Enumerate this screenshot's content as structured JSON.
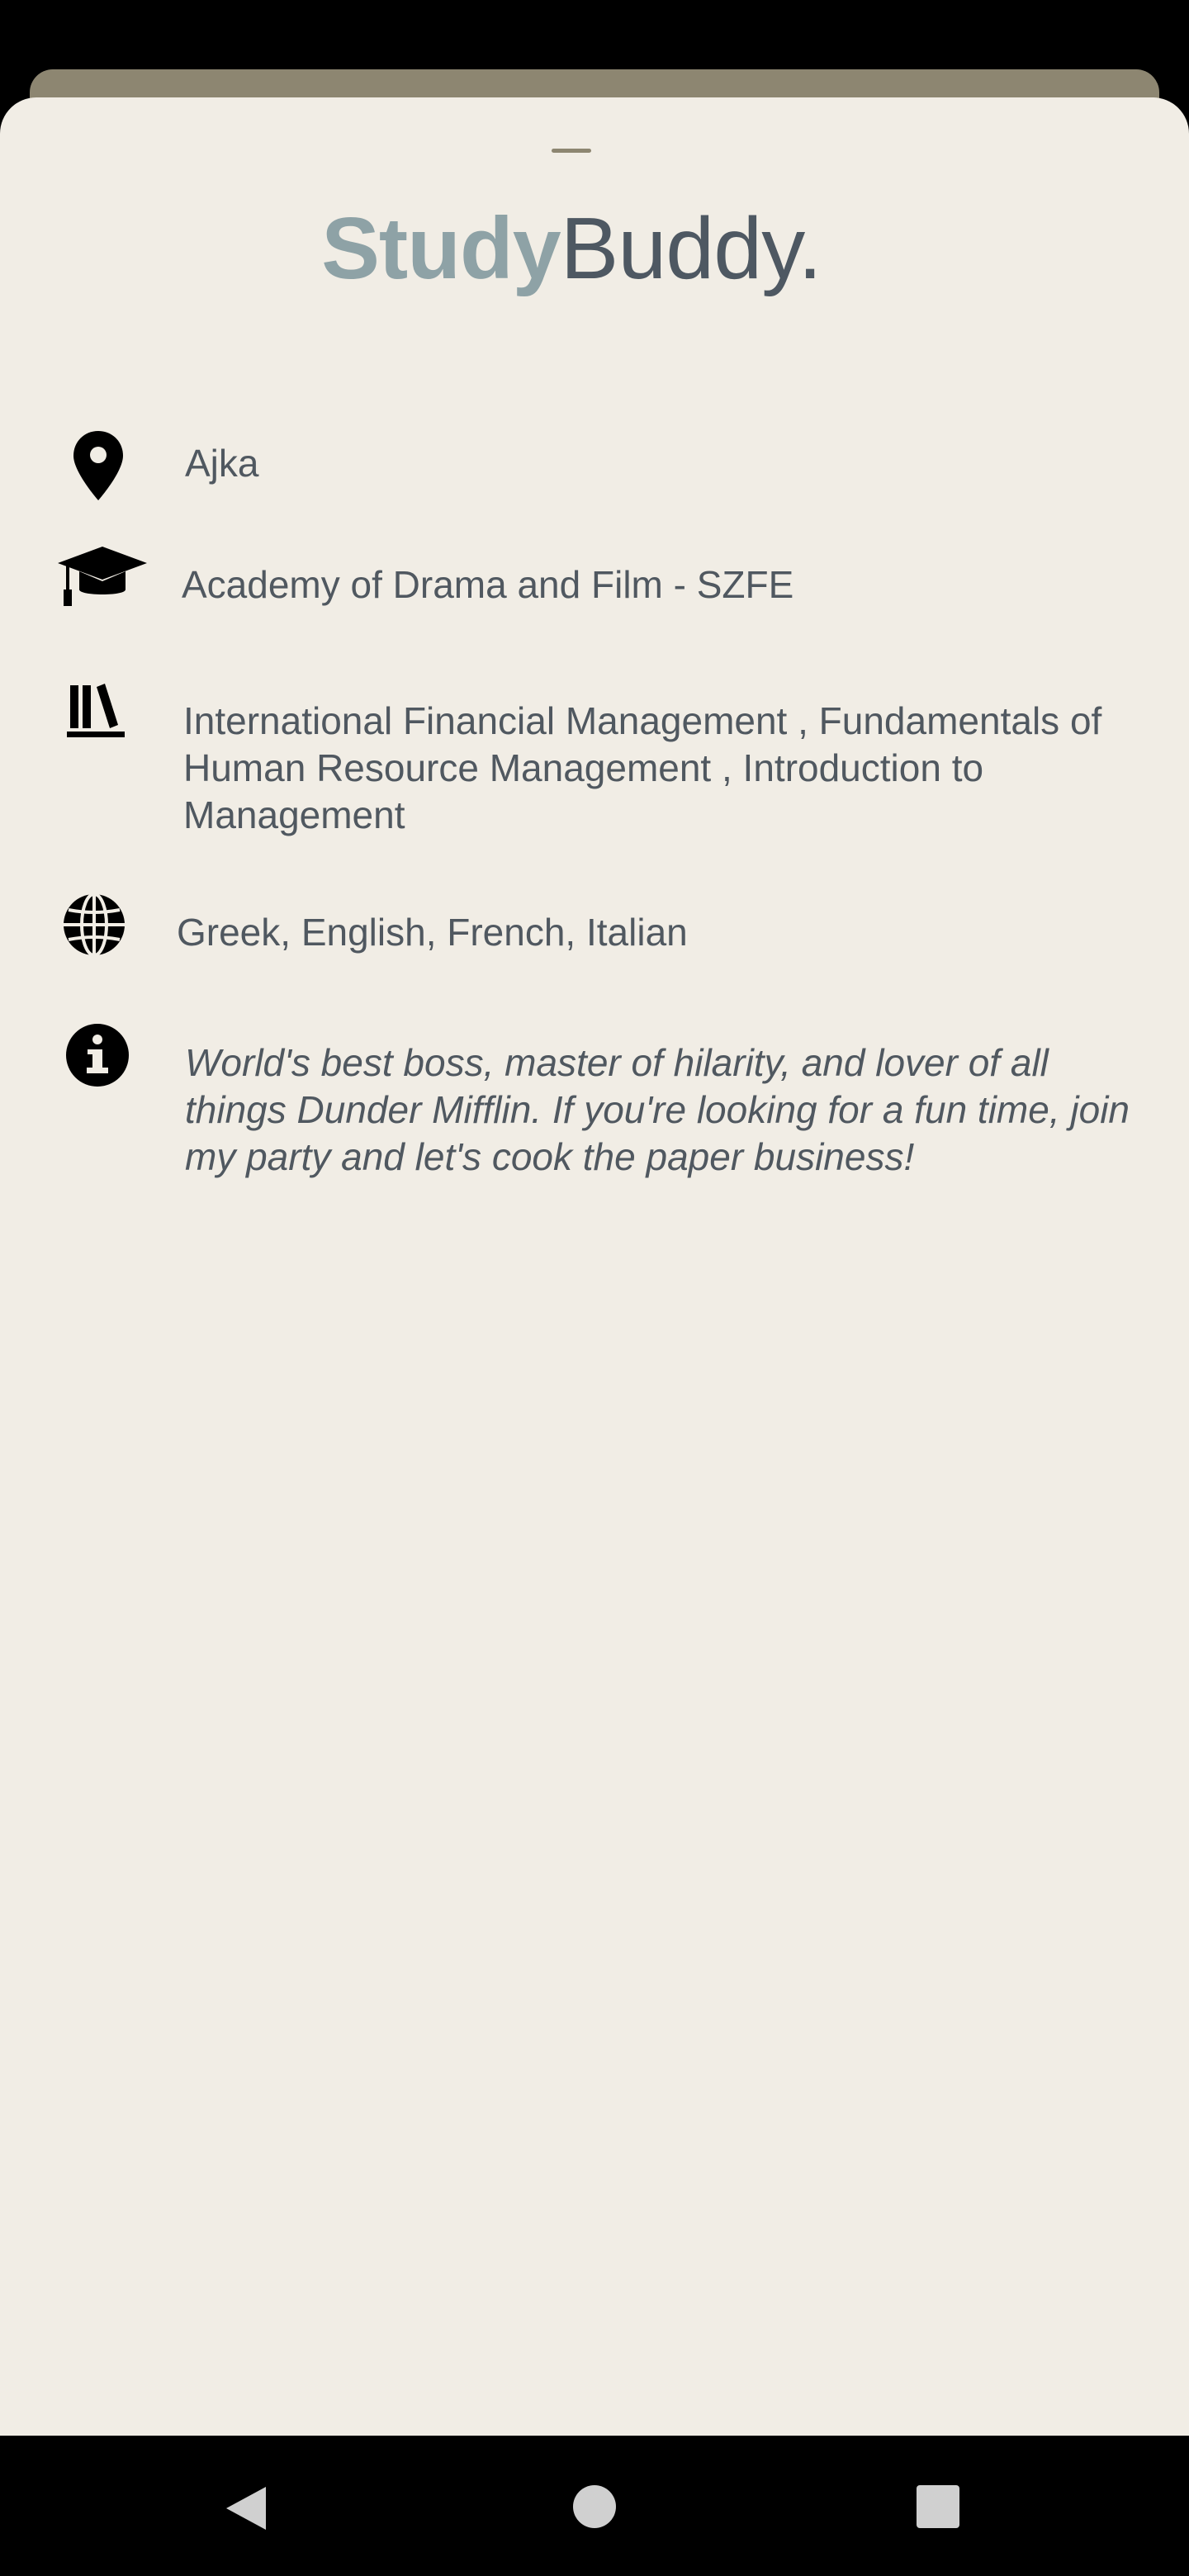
{
  "app": {
    "brand_part1": "Study",
    "brand_part2": "Buddy."
  },
  "profile": {
    "location": "Ajka",
    "university": "Academy of Drama and Film - SZFE",
    "courses": "International Financial Management , Fundamentals of Human Resource Management , Introduction to Management",
    "languages": "Greek, English, French, Italian",
    "bio": "World's best boss, master of hilarity, and lover of all things Dunder Mifflin. If you're looking for a fun time, join my party and let's cook the paper business!"
  },
  "icons": {
    "location": "map-pin-icon",
    "university": "graduation-cap-icon",
    "courses": "books-icon",
    "languages": "globe-icon",
    "bio": "info-icon",
    "nav_back": "back-triangle-icon",
    "nav_home": "home-circle-icon",
    "nav_recents": "recents-square-icon"
  },
  "colors": {
    "sheet_background": "#f1ede5",
    "accent_tan": "#8d8671",
    "brand_study": "#8ea2a6",
    "brand_buddy": "#4e5862",
    "text": "#505860"
  }
}
